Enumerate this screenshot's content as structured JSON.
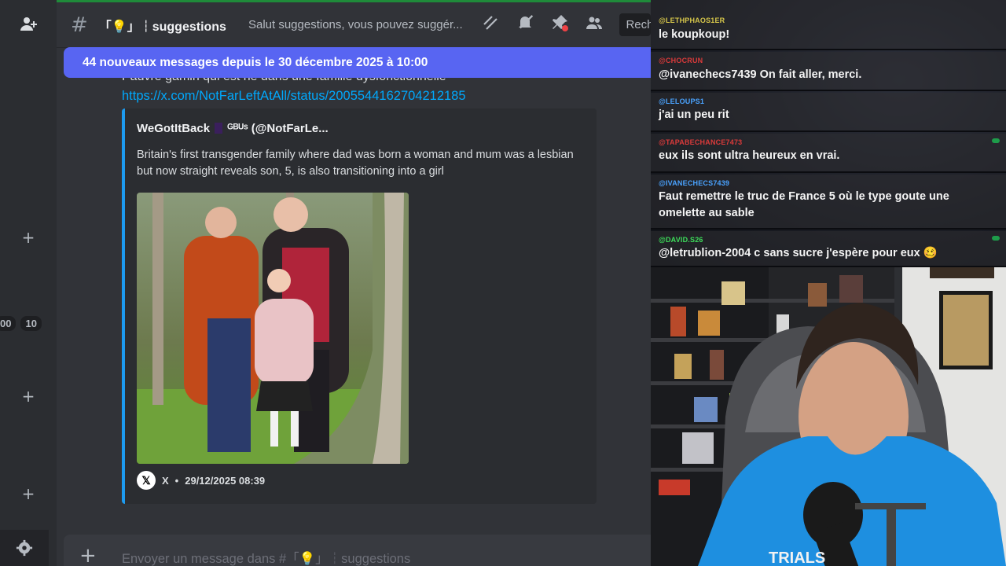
{
  "discord": {
    "channel": {
      "name": "「💡」┆suggestions",
      "topic": "Salut suggestions, vous pouvez suggér...",
      "search_label": "Rech"
    },
    "banner": "44 nouveaux messages depuis le 30 décembre 2025 à 10:00",
    "rail": {
      "count_a": "00",
      "count_b": "10"
    },
    "message": {
      "partial_text": "Pauvre gamin qui est né dans une famille dysfonctionnelle",
      "link": "https://x.com/NotFarLeftAtAll/status/2005544162704212185"
    },
    "embed": {
      "author_name": "WeGotItBack",
      "author_handle": "ᴳᴮᵁˢ (@NotFarLe...",
      "description": "Britain's first transgender family where dad was born a woman and mum was a lesbian but now straight reveals son, 5, is also transitioning into a girl",
      "footer_source": "X",
      "footer_time": "29/12/2025 08:39",
      "x_logo": "𝕏"
    },
    "composer": {
      "placeholder": "Envoyer un message dans #「💡」┆suggestions"
    },
    "colors": {
      "accent": "#5865f2",
      "link": "#00a8fc",
      "embed_border": "#1d9bf0"
    }
  },
  "stream_chat": {
    "messages": [
      {
        "user": "@LETHPHAOS1ER",
        "text": "le koupkoup!",
        "user_color": "#d6c64a"
      },
      {
        "user": "@CHOCRUN",
        "text": "@ivanechecs7439 On fait aller, merci.",
        "user_color": "#d93a3a"
      },
      {
        "user": "@LELOUPS1",
        "text": "j'ai un peu rit",
        "user_color": "#4aa3ff"
      },
      {
        "user": "@TAPABECHANCE7473",
        "text": "eux ils sont ultra heureux en vrai.",
        "user_color": "#d93a3a"
      },
      {
        "user": "@IVANECHECS7439",
        "text": "Faut remettre le truc de France 5 où le type goute une omelette au sable",
        "user_color": "#4aa3ff"
      },
      {
        "user": "@DAVID.S26",
        "text": "@letrublion-2004 c sans sucre j'espère pour eux 🥴",
        "user_color": "#3ddc5a"
      }
    ]
  },
  "webcam": {
    "shirt_text": "TRIALS"
  }
}
